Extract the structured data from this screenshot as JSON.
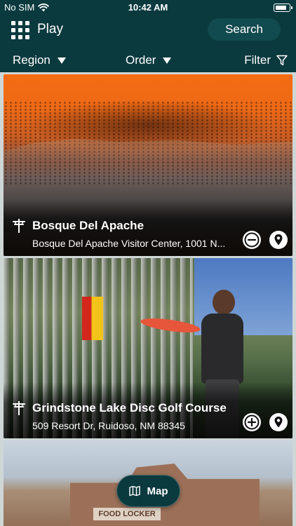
{
  "status_bar": {
    "carrier": "No SIM",
    "time": "10:42 AM"
  },
  "header": {
    "title": "Play",
    "search_label": "Search"
  },
  "filter_bar": {
    "region_label": "Region",
    "order_label": "Order",
    "filter_label": "Filter"
  },
  "courses": [
    {
      "name": "Bosque Del Apache",
      "address": "Bosque Del Apache Visitor Center, 1001 N...",
      "saved": true,
      "save_icon": "minus-circle-icon",
      "location_icon": "map-pin-icon"
    },
    {
      "name": "Grindstone Lake Disc Golf Course",
      "address": "509 Resort Dr, Ruidoso, NM 88345",
      "saved": false,
      "save_icon": "plus-circle-icon",
      "location_icon": "map-pin-icon"
    },
    {
      "sign_text": "FOOD LOCKER"
    }
  ],
  "map_button": {
    "label": "Map",
    "icon": "map-icon"
  },
  "colors": {
    "header_bg": "#0b3a3e",
    "accent_bg": "#114a4f"
  }
}
